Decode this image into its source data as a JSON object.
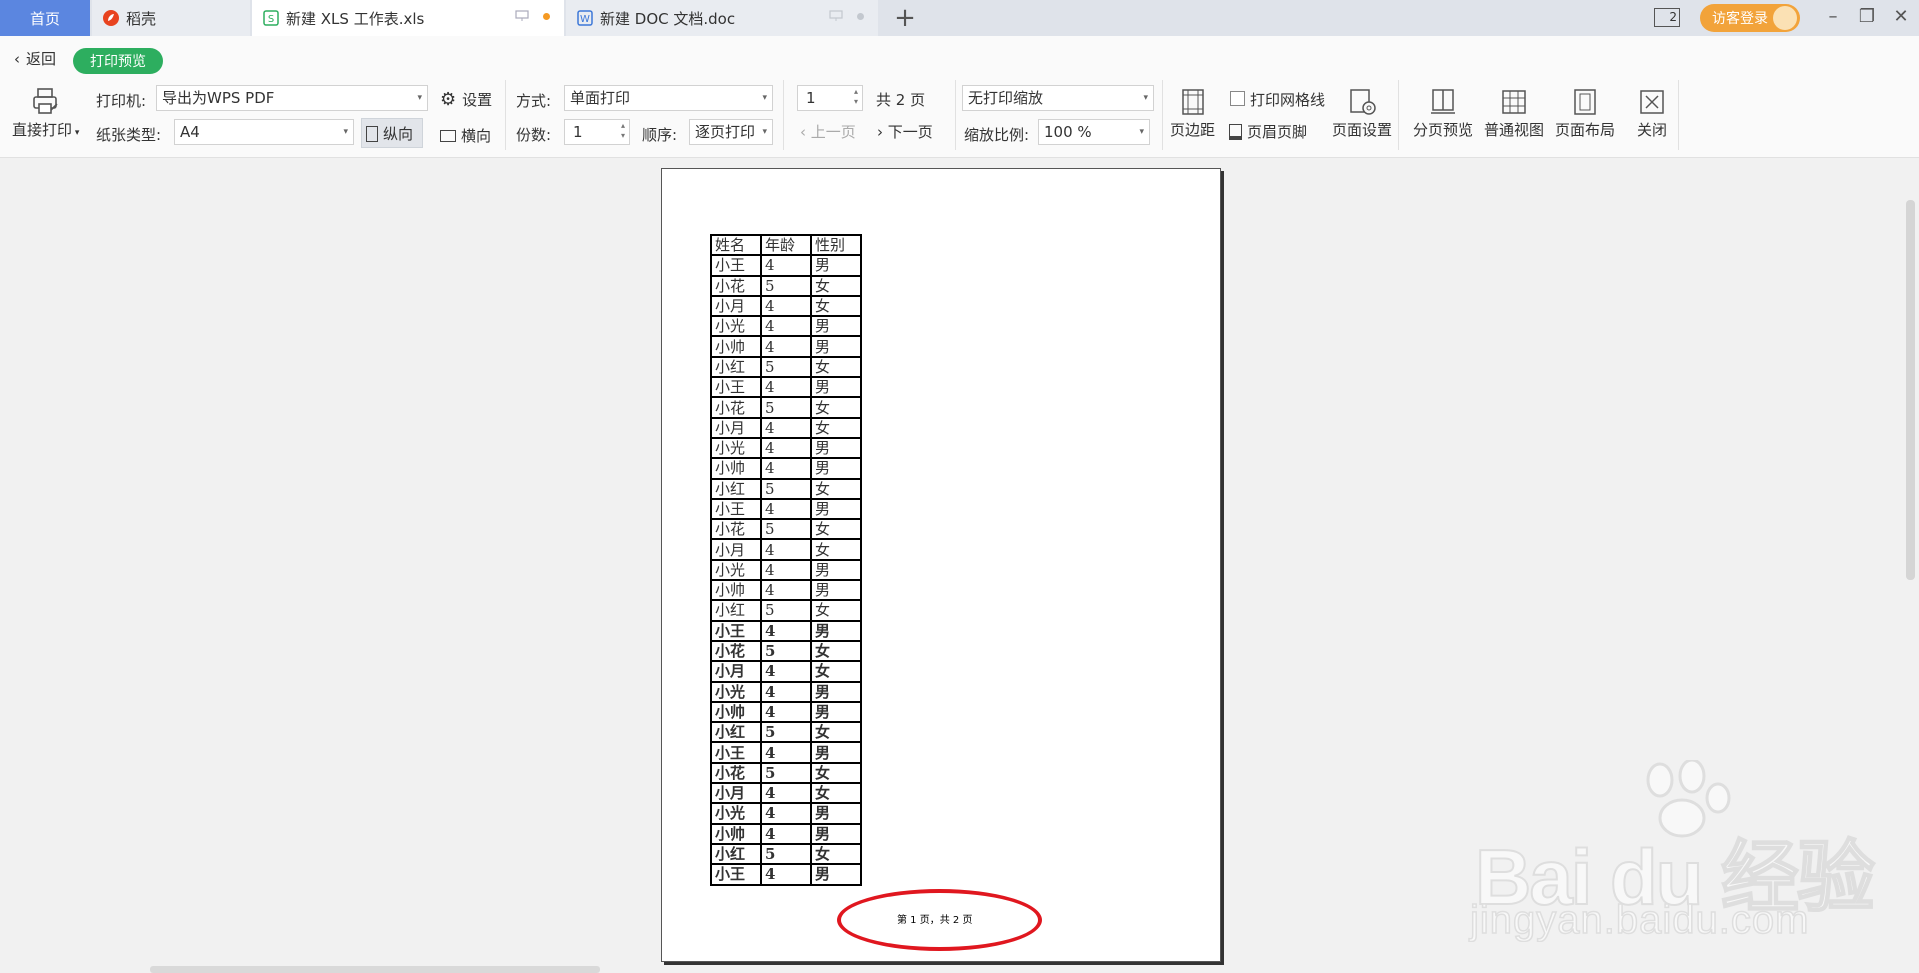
{
  "tabs": {
    "home": "首页",
    "dao": "稻壳",
    "xls": "新建 XLS 工作表.xls",
    "doc": "新建 DOC 文档.doc",
    "new_tab_symbol": "+",
    "window_count": "2",
    "login": "访客登录"
  },
  "toolbar": {
    "back": "返回",
    "mode": "打印预览",
    "direct_print": "直接打印",
    "printer_label": "打印机:",
    "printer_value": "导出为WPS PDF",
    "settings": "设置",
    "paper_label": "纸张类型:",
    "paper_value": "A4",
    "portrait": "纵向",
    "landscape": "横向",
    "method_label": "方式:",
    "method_value": "单面打印",
    "copies_label": "份数:",
    "copies_value": "1",
    "order_label": "顺序:",
    "order_value": "逐页打印",
    "page_value": "1",
    "total_pages": "共 2 页",
    "prev_page": "上一页",
    "next_page": "下一页",
    "scaling_value": "无打印缩放",
    "zoom_label": "缩放比例:",
    "zoom_value": "100 %",
    "margins": "页边距",
    "print_gridlines": "打印网格线",
    "header_footer": "页眉页脚",
    "page_setup": "页面设置",
    "page_break_preview": "分页预览",
    "normal_view": "普通视图",
    "page_layout": "页面布局",
    "close": "关闭"
  },
  "sheet": {
    "headers": [
      "姓名",
      "年龄",
      "性别"
    ],
    "rows": [
      [
        "小王",
        "4",
        "男"
      ],
      [
        "小花",
        "5",
        "女"
      ],
      [
        "小月",
        "4",
        "女"
      ],
      [
        "小光",
        "4",
        "男"
      ],
      [
        "小帅",
        "4",
        "男"
      ],
      [
        "小红",
        "5",
        "女"
      ],
      [
        "小王",
        "4",
        "男"
      ],
      [
        "小花",
        "5",
        "女"
      ],
      [
        "小月",
        "4",
        "女"
      ],
      [
        "小光",
        "4",
        "男"
      ],
      [
        "小帅",
        "4",
        "男"
      ],
      [
        "小红",
        "5",
        "女"
      ],
      [
        "小王",
        "4",
        "男"
      ],
      [
        "小花",
        "5",
        "女"
      ],
      [
        "小月",
        "4",
        "女"
      ],
      [
        "小光",
        "4",
        "男"
      ],
      [
        "小帅",
        "4",
        "男"
      ],
      [
        "小红",
        "5",
        "女"
      ],
      [
        "小王",
        "4",
        "男"
      ],
      [
        "小花",
        "5",
        "女"
      ],
      [
        "小月",
        "4",
        "女"
      ],
      [
        "小光",
        "4",
        "男"
      ],
      [
        "小帅",
        "4",
        "男"
      ],
      [
        "小红",
        "5",
        "女"
      ],
      [
        "小王",
        "4",
        "男"
      ],
      [
        "小花",
        "5",
        "女"
      ],
      [
        "小月",
        "4",
        "女"
      ],
      [
        "小光",
        "4",
        "男"
      ],
      [
        "小帅",
        "4",
        "男"
      ],
      [
        "小红",
        "5",
        "女"
      ],
      [
        "小王",
        "4",
        "男"
      ]
    ],
    "bold_from_row": 18,
    "footer": "第 1 页，共 2 页"
  },
  "watermark": {
    "main": "Bai du 经验",
    "sub": "jingyan.baidu.com"
  },
  "colors": {
    "home_tab": "#5b86e0",
    "preview_pill": "#2dae5f",
    "login": "#f2a33a",
    "annotation": "#e0171f"
  }
}
